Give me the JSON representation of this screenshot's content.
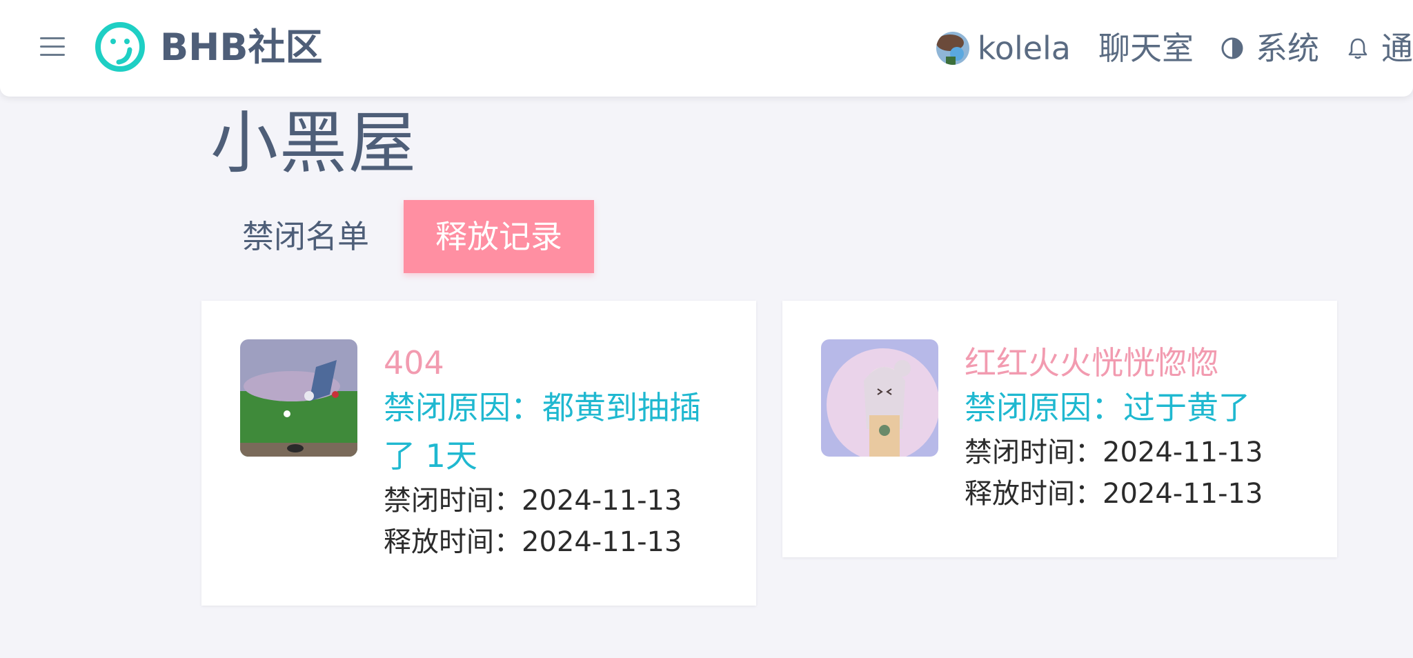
{
  "header": {
    "brand": "BHB社区",
    "user_name": "kolela",
    "chat": "聊天室",
    "system": "系统",
    "notify": "通"
  },
  "page": {
    "title": "小黑屋",
    "tabs": [
      "禁闭名单",
      "释放记录"
    ],
    "active_tab": "释放记录"
  },
  "records": [
    {
      "name": "404",
      "reason": "禁闭原因：都黄到抽插了 1天",
      "ban_time": "禁闭时间：2024-11-13",
      "release_time": "释放时间：2024-11-13"
    },
    {
      "name": "红红火火恍恍惚惚",
      "reason": "禁闭原因：过于黄了",
      "ban_time": "禁闭时间：2024-11-13",
      "release_time": "释放时间：2024-11-13"
    }
  ],
  "colors": {
    "accent": "#ff8fa2",
    "name": "#f29bb0",
    "reason": "#1fb8d0",
    "logo": "#1ecfc4"
  },
  "icons": [
    "menu-icon",
    "smile-logo-icon",
    "contrast-icon",
    "bell-icon"
  ]
}
